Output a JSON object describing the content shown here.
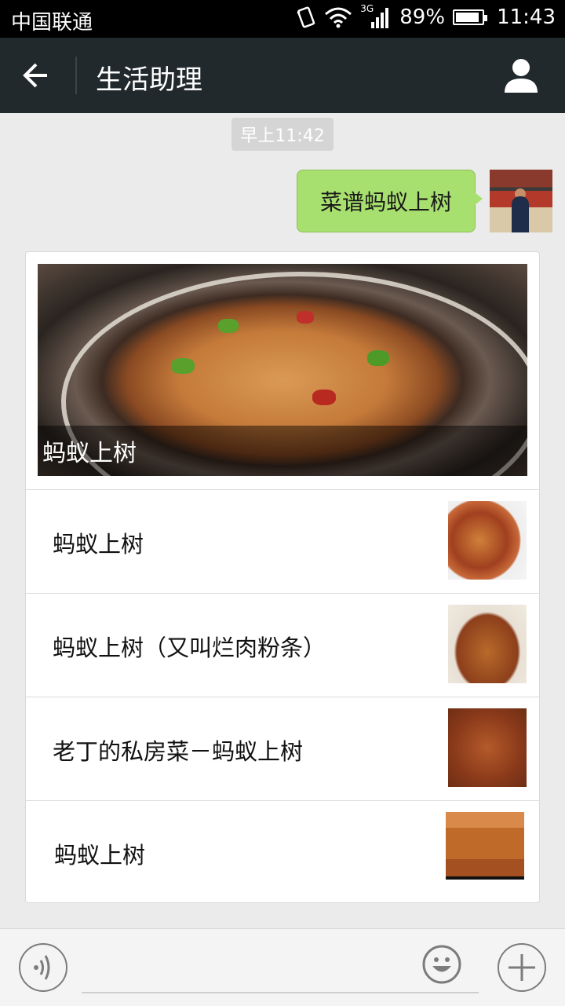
{
  "status_bar": {
    "carrier": "中国联通",
    "network": "3G",
    "battery_percent": "89%",
    "battery_level": 0.89,
    "time": "11:43"
  },
  "header": {
    "title": "生活助理",
    "back_icon": "arrow-left-icon",
    "profile_icon": "person-icon"
  },
  "chat": {
    "timestamp": "早上11:42",
    "sent_message": "菜谱蚂蚁上树"
  },
  "recipe_card": {
    "hero_title": "蚂蚁上树",
    "items": [
      {
        "title": "蚂蚁上树"
      },
      {
        "title": "蚂蚁上树（又叫烂肉粉条）"
      },
      {
        "title": "老丁的私房菜－蚂蚁上树"
      },
      {
        "title": "蚂蚁上树"
      }
    ]
  },
  "input_bar": {
    "voice_icon": "voice-icon",
    "emoji_icon": "smiley-icon",
    "plus_icon": "plus-icon"
  },
  "colors": {
    "titlebar_bg": "#21292c",
    "bubble_bg": "#a8e06f",
    "page_bg": "#ebebeb"
  }
}
